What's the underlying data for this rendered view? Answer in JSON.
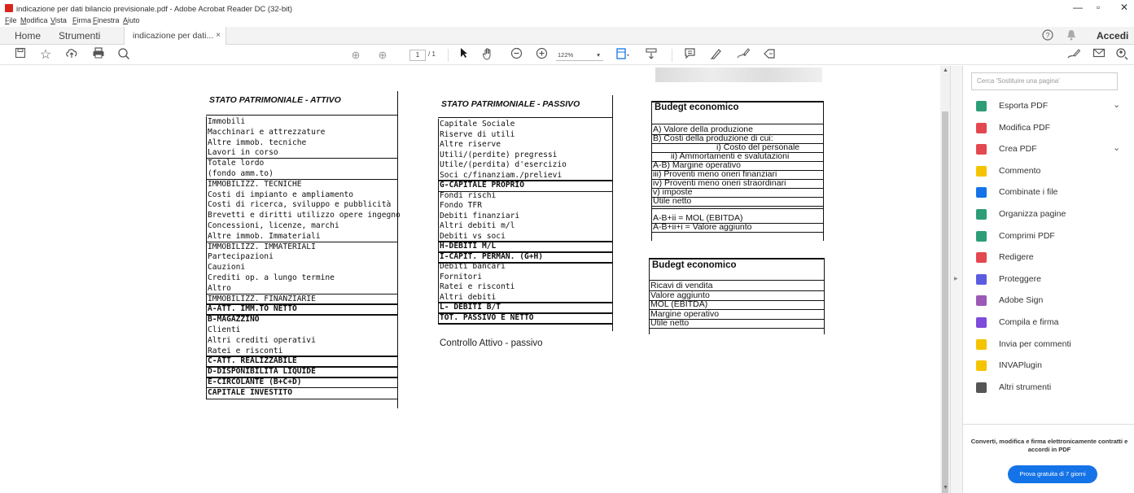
{
  "window": {
    "title": "indicazione per dati bilancio previsionale.pdf - Adobe Acrobat Reader DC (32-bit)",
    "controls": {
      "minimize": "—",
      "maximize": "▫",
      "close": "✕"
    }
  },
  "menu": [
    "File",
    "Modifica",
    "Vista",
    "Firma",
    "Finestra",
    "Aiuto"
  ],
  "tabs": {
    "home": "Home",
    "tools": "Strumenti",
    "document": "indicazione per dati...",
    "close": "×",
    "signin": "Accedi"
  },
  "toolbar": {
    "page_current": "1",
    "page_total": "/ 1",
    "zoom": "122%"
  },
  "attivo": {
    "header": "STATO PATRIMONIALE - ATTIVO",
    "rows": [
      {
        "t": "Immobili",
        "b": false
      },
      {
        "t": "Macchinari e attrezzature",
        "b": false
      },
      {
        "t": "Altre immob. tecniche",
        "b": false
      },
      {
        "t": "Lavori in corso",
        "b": false
      },
      {
        "t": "Totale lordo",
        "b": false
      },
      {
        "t": "(fondo amm.to)",
        "b": false
      },
      {
        "t": "IMMOBILIZZ. TECNICHE",
        "b": false
      },
      {
        "t": "Costi di impianto e ampliamento",
        "b": false
      },
      {
        "t": "Costi di ricerca, sviluppo e pubblicità",
        "b": false
      },
      {
        "t": "Brevetti e diritti utilizzo opere ingegno",
        "b": false
      },
      {
        "t": "Concessioni, licenze, marchi",
        "b": false
      },
      {
        "t": "Altre immob. Immateriali",
        "b": false
      },
      {
        "t": "IMMOBILIZZ. IMMATERIALI",
        "b": false
      },
      {
        "t": "Partecipazioni",
        "b": false
      },
      {
        "t": "Cauzioni",
        "b": false
      },
      {
        "t": "Crediti op. a lungo termine",
        "b": false
      },
      {
        "t": "Altro",
        "b": false
      },
      {
        "t": "IMMOBILIZZ. FINANZIARIE",
        "b": false
      },
      {
        "t": "A-ATT. IMM.TO  NETTO",
        "b": true
      },
      {
        "t": "B-MAGAZZINO",
        "b": true
      },
      {
        "t": "Clienti",
        "b": false
      },
      {
        "t": "Altri crediti operativi",
        "b": false
      },
      {
        "t": "Ratei e risconti",
        "b": false
      },
      {
        "t": "C-ATT. REALIZZABILE",
        "b": true
      },
      {
        "t": "D-DISPONIBILITA LIQUIDE",
        "b": true
      },
      {
        "t": "E-CIRCOLANTE (B+C+D)",
        "b": true
      },
      {
        "t": "CAPITALE INVESTITO",
        "b": true
      }
    ]
  },
  "passivo": {
    "header": "STATO PATRIMONIALE - PASSIVO",
    "rows": [
      {
        "t": "Capitale Sociale",
        "b": false
      },
      {
        "t": "Riserve di utili",
        "b": false
      },
      {
        "t": "Altre riserve",
        "b": false
      },
      {
        "t": "Utili/(perdite) pregressi",
        "b": false
      },
      {
        "t": "Utile/(perdita) d'esercizio",
        "b": false
      },
      {
        "t": "Soci c/finanziam./prelievi",
        "b": false
      },
      {
        "t": "G-CAPITALE PROPRIO",
        "b": true
      },
      {
        "t": "Fondi rischi",
        "b": false
      },
      {
        "t": "Fondo TFR",
        "b": false
      },
      {
        "t": "Debiti finanziari",
        "b": false
      },
      {
        "t": "Altri debiti m/l",
        "b": false
      },
      {
        "t": "Debiti vs soci",
        "b": false
      },
      {
        "t": "H-DEBITI M/L",
        "b": true
      },
      {
        "t": "I-CAPIT. PERMAN. (G+H)",
        "b": true
      },
      {
        "t": "Debiti bancari",
        "b": false
      },
      {
        "t": "Fornitori",
        "b": false
      },
      {
        "t": "Ratei e risconti",
        "b": false
      },
      {
        "t": "Altri debiti",
        "b": false
      },
      {
        "t": "L- DEBITI B/T",
        "b": true
      },
      {
        "t": "TOT. PASSIVO E NETTO",
        "b": true
      }
    ],
    "controllo": "Controllo Attivo - passivo"
  },
  "budget1": {
    "title": "Budegt economico",
    "rows": [
      "A) Valore della produzione",
      "B) Costi della produzione di cui:",
      "i) Costo del personale",
      "ii) Ammortamenti e svalutazioni",
      "A-B) Margine operativo",
      "iii) Proventi meno oneri finanziari",
      "iv) Proventi meno oneri straordinari",
      "v) imposte",
      "Utile netto",
      "A-B+ii = MOL (EBITDA)",
      "A-B+ii+i = Valore aggiunto"
    ]
  },
  "budget2": {
    "title": "Budegt economico",
    "rows": [
      "Ricavi di vendita",
      "Valore aggiunto",
      "MOL (EBITDA)",
      "Margine operativo",
      "Utile netto"
    ]
  },
  "rightpanel": {
    "search_placeholder": "Cerca 'Sostituire una pagina'",
    "tools": [
      {
        "label": "Esporta PDF",
        "icon": "export-pdf-icon",
        "color": "#2d9d78",
        "chevron": true
      },
      {
        "label": "Modifica PDF",
        "icon": "edit-pdf-icon",
        "color": "#e34850",
        "chevron": false
      },
      {
        "label": "Crea PDF",
        "icon": "create-pdf-icon",
        "color": "#e34850",
        "chevron": true
      },
      {
        "label": "Commento",
        "icon": "comment-icon",
        "color": "#f5c400",
        "chevron": false
      },
      {
        "label": "Combinate i file",
        "icon": "combine-files-icon",
        "color": "#1473e6",
        "chevron": false
      },
      {
        "label": "Organizza pagine",
        "icon": "organize-pages-icon",
        "color": "#2d9d78",
        "chevron": false
      },
      {
        "label": "Comprimi PDF",
        "icon": "compress-pdf-icon",
        "color": "#2d9d78",
        "chevron": false
      },
      {
        "label": "Redigere",
        "icon": "redact-icon",
        "color": "#e34850",
        "chevron": false
      },
      {
        "label": "Proteggere",
        "icon": "protect-icon",
        "color": "#5c5ce0",
        "chevron": false
      },
      {
        "label": "Adobe Sign",
        "icon": "adobe-sign-icon",
        "color": "#9b59b6",
        "chevron": false
      },
      {
        "label": "Compila e firma",
        "icon": "fill-sign-icon",
        "color": "#7d4cdb",
        "chevron": false
      },
      {
        "label": "Invia per commenti",
        "icon": "send-comments-icon",
        "color": "#f5c400",
        "chevron": false
      },
      {
        "label": "INVAPlugin",
        "icon": "plugin-icon",
        "color": "#f5c400",
        "chevron": false
      },
      {
        "label": "Altri strumenti",
        "icon": "more-tools-icon",
        "color": "#555555",
        "chevron": false
      }
    ],
    "promo_text": "Converti, modifica e firma elettronicamente contratti e accordi in PDF",
    "promo_button": "Prova gratuita di 7 giorni"
  }
}
